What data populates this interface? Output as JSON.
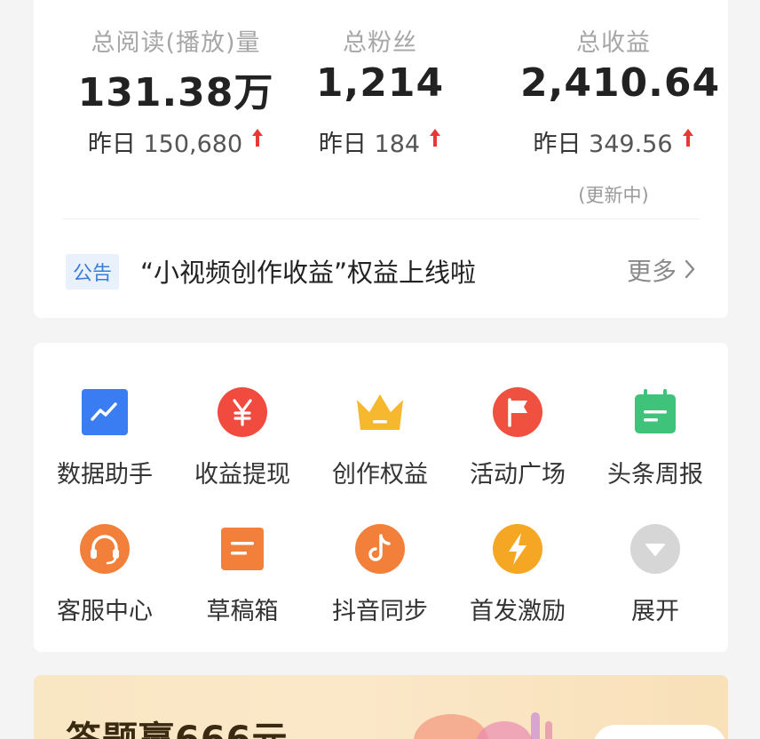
{
  "stats": {
    "reads": {
      "label": "总阅读(播放)量",
      "value": "131.38万",
      "yesterday_label": "昨日",
      "yesterday_value": "150,680"
    },
    "fans": {
      "label": "总粉丝",
      "value": "1,214",
      "yesterday_label": "昨日",
      "yesterday_value": "184"
    },
    "income": {
      "label": "总收益",
      "value": "2,410.64",
      "yesterday_label": "昨日",
      "yesterday_value": "349.56",
      "note": "(更新中)"
    },
    "up_arrow_color": "#e53935"
  },
  "notice": {
    "badge": "公告",
    "text": "“小视频创作收益”权益上线啦",
    "more": "更多"
  },
  "tools": [
    {
      "label": "数据助手",
      "icon": "chart-icon",
      "color": "#3a7cf2"
    },
    {
      "label": "收益提现",
      "icon": "yuan-icon",
      "color": "#f04b3e"
    },
    {
      "label": "创作权益",
      "icon": "crown-icon",
      "color": "#f5b82e"
    },
    {
      "label": "活动广场",
      "icon": "flag-icon",
      "color": "#f0503f"
    },
    {
      "label": "头条周报",
      "icon": "calendar-icon",
      "color": "#3fc27a"
    },
    {
      "label": "客服中心",
      "icon": "headset-icon",
      "color": "#f2803a"
    },
    {
      "label": "草稿箱",
      "icon": "draft-icon",
      "color": "#f2803a"
    },
    {
      "label": "抖音同步",
      "icon": "douyin-icon",
      "color": "#f2803a"
    },
    {
      "label": "首发激励",
      "icon": "lightning-icon",
      "color": "#f5a623"
    },
    {
      "label": "展开",
      "icon": "expand-icon",
      "color": "#d6d6d6"
    }
  ],
  "banner": {
    "title": "答题赢666元"
  }
}
